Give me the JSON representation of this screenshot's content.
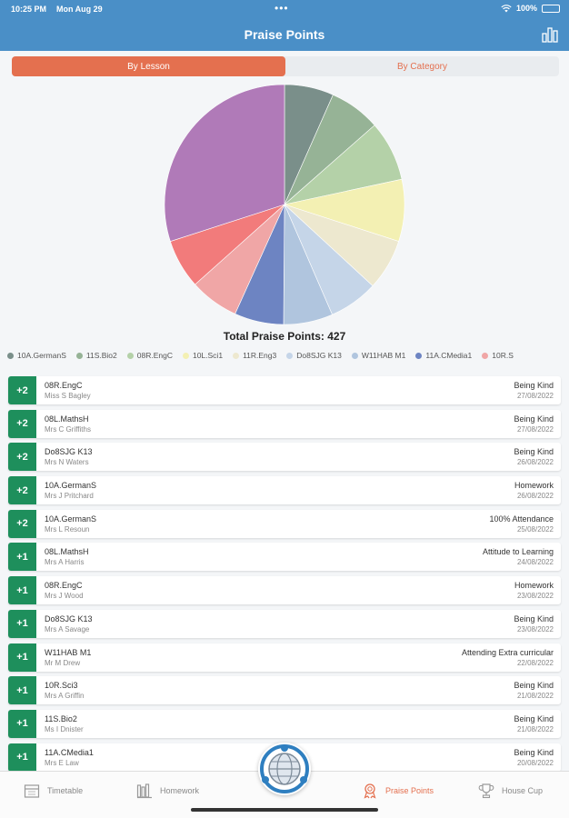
{
  "status_bar": {
    "time": "10:25 PM",
    "date": "Mon Aug 29",
    "dots": "•••",
    "battery": "100%"
  },
  "nav": {
    "title": "Praise Points",
    "chart_icon": "bar-chart-icon"
  },
  "segments": {
    "by_lesson": "By Lesson",
    "by_category": "By Category",
    "selected": "By Lesson"
  },
  "chart_data": {
    "type": "pie",
    "total_label": "Total Praise Points: 427",
    "slices": [
      {
        "label": "10A.GermanS",
        "value": 27,
        "color": "#7a8f8a"
      },
      {
        "label": "11S.Bio2",
        "value": 28,
        "color": "#96b396"
      },
      {
        "label": "08R.EngC",
        "value": 33,
        "color": "#b4d1a8"
      },
      {
        "label": "10L.Sci1",
        "value": 34,
        "color": "#f3f0b3"
      },
      {
        "label": "11R.Eng3",
        "value": 28,
        "color": "#ede8cf"
      },
      {
        "label": "Do8SJG K13",
        "value": 27,
        "color": "#c5d5e8"
      },
      {
        "label": "W11HAB M1",
        "value": 27,
        "color": "#b0c5de"
      },
      {
        "label": "11A.CMedia1",
        "value": 27,
        "color": "#6d84c2"
      },
      {
        "label": "10R.Sci3",
        "value": 27,
        "color": "#f0a6a6"
      },
      {
        "label": "08L.MathsH",
        "value": 27,
        "color": "#f27b7b"
      },
      {
        "label": "",
        "value": 122,
        "color": "#b07ab8"
      }
    ]
  },
  "legend": [
    {
      "label": "10A.GermanS",
      "color": "#7a8f8a"
    },
    {
      "label": "11S.Bio2",
      "color": "#96b396"
    },
    {
      "label": "08R.EngC",
      "color": "#b4d1a8"
    },
    {
      "label": "10L.Sci1",
      "color": "#f3f0b3"
    },
    {
      "label": "11R.Eng3",
      "color": "#ede8cf"
    },
    {
      "label": "Do8SJG K13",
      "color": "#c5d5e8"
    },
    {
      "label": "W11HAB M1",
      "color": "#b0c5de"
    },
    {
      "label": "11A.CMedia1",
      "color": "#6d84c2"
    },
    {
      "label": "10R.S",
      "color": "#f0a6a6"
    }
  ],
  "entries": [
    {
      "points": "+2",
      "lesson": "08R.EngC",
      "teacher": "Miss S Bagley",
      "category": "Being Kind",
      "date": "27/08/2022"
    },
    {
      "points": "+2",
      "lesson": "08L.MathsH",
      "teacher": "Mrs C Griffiths",
      "category": "Being Kind",
      "date": "27/08/2022"
    },
    {
      "points": "+2",
      "lesson": "Do8SJG K13",
      "teacher": "Mrs N Waters",
      "category": "Being Kind",
      "date": "26/08/2022"
    },
    {
      "points": "+2",
      "lesson": "10A.GermanS",
      "teacher": "Mrs J Pritchard",
      "category": "Homework",
      "date": "26/08/2022"
    },
    {
      "points": "+2",
      "lesson": "10A.GermanS",
      "teacher": "Mrs L Resoun",
      "category": "100% Attendance",
      "date": "25/08/2022"
    },
    {
      "points": "+1",
      "lesson": "08L.MathsH",
      "teacher": "Mrs A Harris",
      "category": "Attitude to Learning",
      "date": "24/08/2022"
    },
    {
      "points": "+1",
      "lesson": "08R.EngC",
      "teacher": "Mrs J Wood",
      "category": "Homework",
      "date": "23/08/2022"
    },
    {
      "points": "+1",
      "lesson": "Do8SJG K13",
      "teacher": "Mrs A Savage",
      "category": "Being Kind",
      "date": "23/08/2022"
    },
    {
      "points": "+1",
      "lesson": "W11HAB M1",
      "teacher": "Mr M Drew",
      "category": "Attending Extra curricular",
      "date": "22/08/2022"
    },
    {
      "points": "+1",
      "lesson": "10R.Sci3",
      "teacher": "Mrs A Griffin",
      "category": "Being Kind",
      "date": "21/08/2022"
    },
    {
      "points": "+1",
      "lesson": "11S.Bio2",
      "teacher": "Ms I Dnister",
      "category": "Being Kind",
      "date": "21/08/2022"
    },
    {
      "points": "+1",
      "lesson": "11A.CMedia1",
      "teacher": "Mrs E Law",
      "category": "Being Kind",
      "date": "20/08/2022"
    }
  ],
  "tabs": {
    "timetable": "Timetable",
    "homework": "Homework",
    "praise_points": "Praise Points",
    "house_cup": "House Cup"
  },
  "colors": {
    "header": "#4a8fc7",
    "accent": "#e4704f",
    "points_badge": "#1e8f5c"
  }
}
